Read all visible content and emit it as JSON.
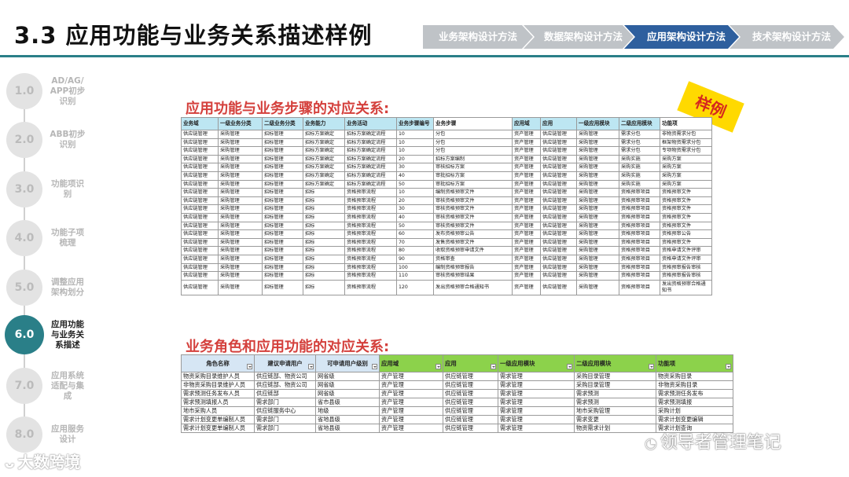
{
  "page": {
    "title": "3.3 应用功能与业务关系描述样例"
  },
  "nav": [
    {
      "label": "业务架构设计方法",
      "active": false
    },
    {
      "label": "数据架构设计方法",
      "active": false
    },
    {
      "label": "应用架构设计方法",
      "active": true
    },
    {
      "label": "技术架构设计方法",
      "active": false
    }
  ],
  "timeline": [
    {
      "num": "1.0",
      "label": "AD/AG/ APP初步 识别",
      "active": false
    },
    {
      "num": "2.0",
      "label": "ABB初步 识别",
      "active": false
    },
    {
      "num": "3.0",
      "label": "功能项识 别",
      "active": false
    },
    {
      "num": "4.0",
      "label": "功能子项 梳理",
      "active": false
    },
    {
      "num": "5.0",
      "label": "调整应用 架构划分",
      "active": false
    },
    {
      "num": "6.0",
      "label": "应用功能 与业务关 系描述",
      "active": true
    },
    {
      "num": "7.0",
      "label": "应用系统 适配与集 成",
      "active": false
    },
    {
      "num": "8.0",
      "label": "应用服务 设计",
      "active": false
    }
  ],
  "section1": {
    "title": "应用功能与业务步骤的对应关系:",
    "stamp": "样例",
    "headers": [
      "业务域",
      "一级业务分类",
      "二级业务分类",
      "业务能力",
      "业务活动",
      "业务步骤编号",
      "业务步骤",
      "应用域",
      "应用",
      "一级应用模块",
      "二级应用模块",
      "功能项"
    ],
    "rows": [
      [
        "供应链管理",
        "采购管理",
        "招标管理",
        "招标方案确定",
        "招标方案确定流程",
        "10",
        "分包",
        "资产管理",
        "供应链管理",
        "采购管理",
        "需求分包",
        "非物资需求分包"
      ],
      [
        "供应链管理",
        "采购管理",
        "招标管理",
        "招标方案确定",
        "招标方案确定流程",
        "10",
        "分包",
        "资产管理",
        "供应链管理",
        "采购管理",
        "需求分包",
        "框架物资需求分包"
      ],
      [
        "供应链管理",
        "采购管理",
        "招标管理",
        "招标方案确定",
        "招标方案确定流程",
        "10",
        "分包",
        "资产管理",
        "供应链管理",
        "采购管理",
        "需求分包",
        "专项物资需求分包"
      ],
      [
        "供应链管理",
        "采购管理",
        "招标管理",
        "招标方案确定",
        "招标方案确定流程",
        "20",
        "招标方案编制",
        "资产管理",
        "供应链管理",
        "采购管理",
        "采购实施",
        "采购方案"
      ],
      [
        "供应链管理",
        "采购管理",
        "招标管理",
        "招标方案确定",
        "招标方案确定流程",
        "30",
        "审核招标方案",
        "资产管理",
        "供应链管理",
        "采购管理",
        "采购实施",
        "采购方案"
      ],
      [
        "供应链管理",
        "采购管理",
        "招标管理",
        "招标方案确定",
        "招标方案确定流程",
        "40",
        "审批招标方案",
        "资产管理",
        "供应链管理",
        "采购管理",
        "采购实施",
        "采购方案"
      ],
      [
        "供应链管理",
        "采购管理",
        "招标管理",
        "招标方案确定",
        "招标方案确定流程",
        "50",
        "审批招标方案",
        "资产管理",
        "供应链管理",
        "采购管理",
        "采购实施",
        "采购方案"
      ],
      [
        "供应链管理",
        "采购管理",
        "招标管理",
        "招标",
        "资格预审流程",
        "10",
        "编制资格预审文件",
        "资产管理",
        "供应链管理",
        "采购管理",
        "资格预审项目",
        "资格预审文件"
      ],
      [
        "供应链管理",
        "采购管理",
        "招标管理",
        "招标",
        "资格预审流程",
        "20",
        "审核资格预审文件",
        "资产管理",
        "供应链管理",
        "采购管理",
        "资格预审项目",
        "资格预审文件"
      ],
      [
        "供应链管理",
        "采购管理",
        "招标管理",
        "招标",
        "资格预审流程",
        "30",
        "审核资格预审文件",
        "资产管理",
        "供应链管理",
        "采购管理",
        "资格预审项目",
        "资格预审文件"
      ],
      [
        "供应链管理",
        "采购管理",
        "招标管理",
        "招标",
        "资格预审流程",
        "40",
        "审核资格预审文件",
        "资产管理",
        "供应链管理",
        "采购管理",
        "资格预审项目",
        "资格预审文件"
      ],
      [
        "供应链管理",
        "采购管理",
        "招标管理",
        "招标",
        "资格预审流程",
        "50",
        "审核资格预审文件",
        "资产管理",
        "供应链管理",
        "采购管理",
        "资格预审项目",
        "资格预审文件"
      ],
      [
        "供应链管理",
        "采购管理",
        "招标管理",
        "招标",
        "资格预审流程",
        "60",
        "发布资格预审公告",
        "资产管理",
        "供应链管理",
        "采购管理",
        "资格预审项目",
        "资格预审公告"
      ],
      [
        "供应链管理",
        "采购管理",
        "招标管理",
        "招标",
        "资格预审流程",
        "70",
        "发售资格预审文件",
        "资产管理",
        "供应链管理",
        "采购管理",
        "资格预审项目",
        "资格预审文件"
      ],
      [
        "供应链管理",
        "采购管理",
        "招标管理",
        "招标",
        "资格预审流程",
        "80",
        "收取资格预审申请文件",
        "资产管理",
        "供应链管理",
        "采购管理",
        "资格预审项目",
        "资格申请文件评审"
      ],
      [
        "供应链管理",
        "采购管理",
        "招标管理",
        "招标",
        "资格预审流程",
        "90",
        "资格审查",
        "资产管理",
        "供应链管理",
        "采购管理",
        "资格预审项目",
        "资格申请文件评审"
      ],
      [
        "供应链管理",
        "采购管理",
        "招标管理",
        "招标",
        "资格预审流程",
        "100",
        "编制资格预审报告",
        "资产管理",
        "供应链管理",
        "采购管理",
        "资格预审项目",
        "资格预审报告审核"
      ],
      [
        "供应链管理",
        "采购管理",
        "招标管理",
        "招标",
        "资格预审流程",
        "110",
        "审核资格预审结果",
        "资产管理",
        "供应链管理",
        "采购管理",
        "资格预审项目",
        "资格预审报告审核"
      ],
      [
        "供应链管理",
        "采购管理",
        "招标管理",
        "招标",
        "资格预审流程",
        "120",
        "发出资格预审合格通知书",
        "资产管理",
        "供应链管理",
        "采购管理",
        "资格预审项目",
        "发出资格预审合格通知书"
      ]
    ]
  },
  "section2": {
    "title": "业务角色和应用功能的对应关系:",
    "headers": [
      "角色名称",
      "建议申请用户",
      "可申请用户级别",
      "应用域",
      "应用",
      "一级应用模块",
      "二级应用模块",
      "功能项"
    ],
    "rows": [
      [
        "物资采购目录维护人员",
        "供应链部、物资公司",
        "网省级",
        "资产管理",
        "供应链管理",
        "需求管理",
        "采购目录管理",
        "物资采购目录"
      ],
      [
        "非物资采购目录维护人员",
        "供应链部、物资公司",
        "网省级",
        "资产管理",
        "供应链管理",
        "需求管理",
        "采购目录管理",
        "非物资采购目录"
      ],
      [
        "需求预测任务发布人员",
        "供应链部",
        "网省级",
        "资产管理",
        "供应链管理",
        "需求管理",
        "需求预测",
        "需求预测任务发布"
      ],
      [
        "需求预测填报人员",
        "需求部门",
        "省市县级",
        "资产管理",
        "供应链管理",
        "需求管理",
        "需求预测",
        "需求预测填报"
      ],
      [
        "地市采购人员",
        "供应链服务中心",
        "地级",
        "资产管理",
        "供应链管理",
        "需求管理",
        "地市采购管理",
        "采购计划"
      ],
      [
        "需求计划变更单编制人员",
        "需求部门",
        "省地县级",
        "资产管理",
        "供应链管理",
        "需求管理",
        "需求变更",
        "需求计划变更编辑"
      ],
      [
        "需求计划变更单编制人员",
        "需求部门",
        "省地县级",
        "资产管理",
        "供应链管理",
        "需求管理",
        "物资需求计划",
        "需求计划查询"
      ]
    ]
  },
  "watermarks": {
    "left": "大数跨境",
    "right": "领导者管理笔记"
  }
}
